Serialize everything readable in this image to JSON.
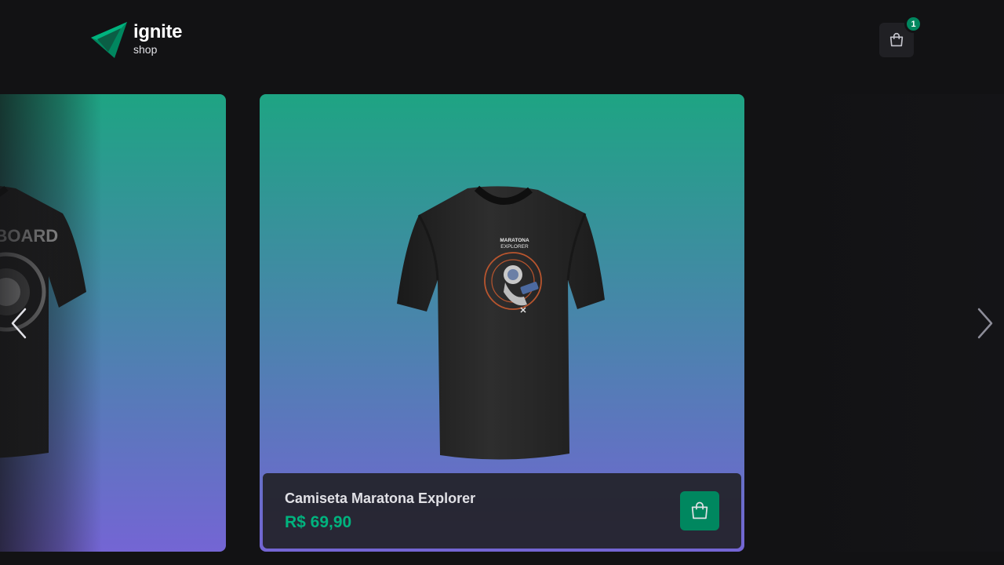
{
  "header": {
    "logo_title": "ignite",
    "logo_subtitle": "shop",
    "cart_count": "1",
    "cart_icon": "shopping-bag-icon"
  },
  "carousel": {
    "prev_icon": "chevron-left-icon",
    "next_icon": "chevron-right-icon",
    "products": [
      {
        "print_text": "ER ABOARD"
      },
      {
        "name": "Camiseta Maratona Explorer",
        "price": "R$ 69,90",
        "print_text_1": "MARATONA",
        "print_text_2": "EXPLORER",
        "add_icon": "shopping-bag-icon"
      }
    ]
  },
  "colors": {
    "background": "#121214",
    "brand_green": "#00875f",
    "price_green": "#00b37e",
    "card_gradient_top": "#1ea483",
    "card_gradient_bottom": "#7465d4",
    "footer_bar": "#202024"
  }
}
